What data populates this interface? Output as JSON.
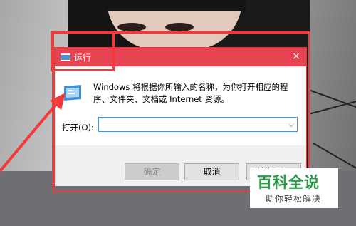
{
  "dialog": {
    "title": "运行",
    "close_symbol": "×",
    "description": "Windows 将根据你所输入的名称，为你打开相应的程序、文件夹、文档或 Internet 资源。",
    "open_label": "打开(O):",
    "open_value": "",
    "dropdown_symbol": "⌵",
    "buttons": {
      "ok": "确定",
      "cancel": "取消",
      "browse": "浏览(B)..."
    }
  },
  "watermark": {
    "main": "百科全说",
    "sub": "助你轻松解决"
  },
  "icons": [
    "run-app-icon",
    "close-icon",
    "dropdown-arrow-icon"
  ],
  "colors": {
    "titlebar": "#e84351",
    "annotation": "#f23a3a",
    "watermark_green": "#2d9a4a"
  }
}
